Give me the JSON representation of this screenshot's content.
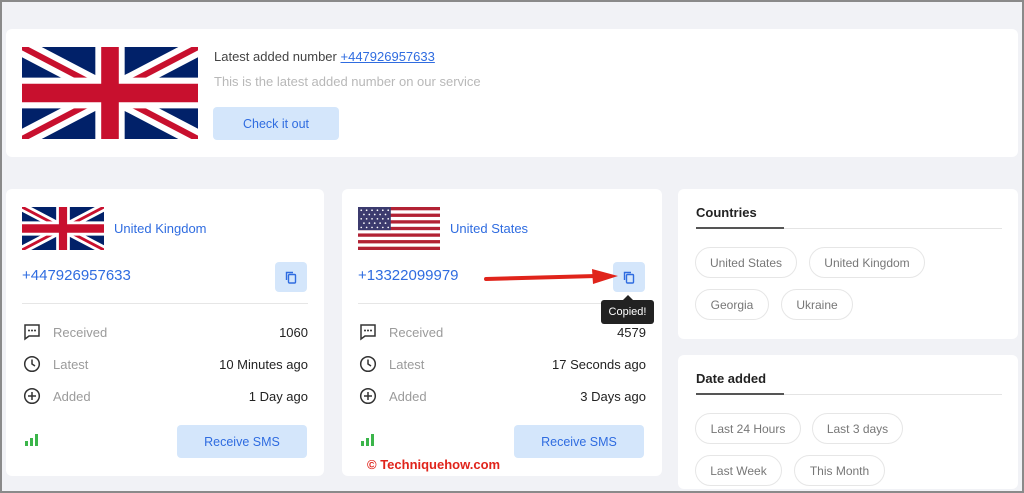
{
  "banner": {
    "title_prefix": "Latest added number",
    "title_number": "+447926957633",
    "subtitle": "This is the latest added number on our service",
    "button": "Check it out",
    "flag_icon": "uk-flag-icon"
  },
  "cards": [
    {
      "country": "United Kingdom",
      "flag_icon": "uk-flag-icon",
      "phone": "+447926957633",
      "received_label": "Received",
      "received_value": "1060",
      "latest_label": "Latest",
      "latest_value": "10 Minutes ago",
      "added_label": "Added",
      "added_value": "1 Day ago",
      "button": "Receive SMS"
    },
    {
      "country": "United States",
      "flag_icon": "us-flag-icon",
      "phone": "+13322099979",
      "received_label": "Received",
      "received_value": "4579",
      "latest_label": "Latest",
      "latest_value": "17 Seconds ago",
      "added_label": "Added",
      "added_value": "3 Days ago",
      "button": "Receive SMS"
    }
  ],
  "tooltip": "Copied!",
  "watermark": "© Techniquehow.com",
  "countries_panel": {
    "title": "Countries",
    "chips": [
      "United States",
      "United Kingdom",
      "Georgia",
      "Ukraine"
    ]
  },
  "date_panel": {
    "title": "Date added",
    "chips": [
      "Last 24 Hours",
      "Last 3 days",
      "Last Week",
      "This Month"
    ]
  },
  "colors": {
    "accent": "#2f6ce0",
    "button_bg": "#d4e6fb",
    "signal": "#3bb54a",
    "annotation": "#e0241b"
  }
}
